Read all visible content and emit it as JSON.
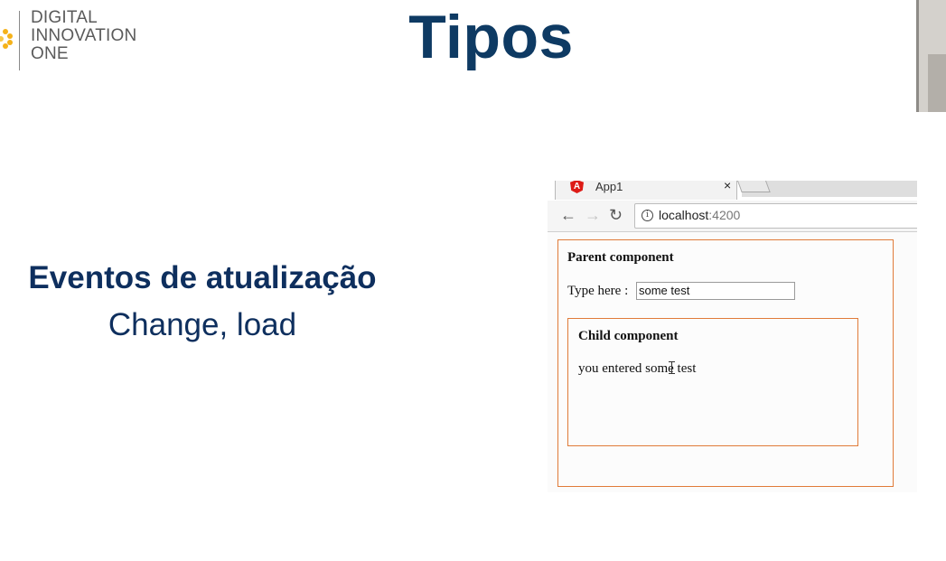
{
  "brand": {
    "line1": "DIGITAL",
    "line2": "INNOVATION",
    "line3": "ONE"
  },
  "slide": {
    "title": "Tipos",
    "heading": "Eventos de atualização",
    "subheading": "Change, load"
  },
  "browser": {
    "tab_label": "App1",
    "tab_close": "×",
    "url_host": "localhost",
    "url_port": ":4200",
    "parent_title": "Parent component",
    "type_label": "Type here :",
    "input_value": "some test",
    "child_title": "Child component",
    "child_text": "you entered some test"
  },
  "colors": {
    "title": "#0e3a63",
    "accent_border": "#e07b39",
    "angular_red": "#dd1b16"
  }
}
